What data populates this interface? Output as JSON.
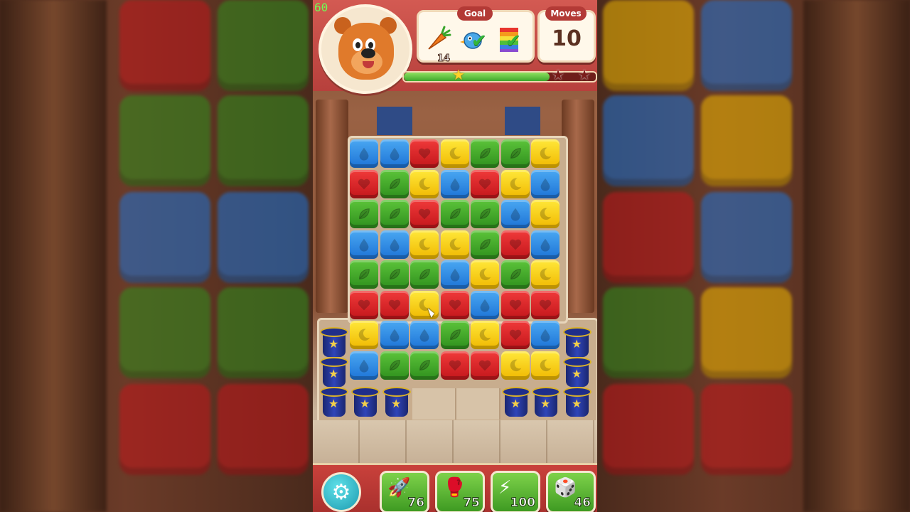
{
  "hud": {
    "fps": "60",
    "goal_label": "Goal",
    "moves_label": "Moves",
    "moves_value": "10",
    "goals": [
      {
        "icon": "carrot-icon",
        "count": "14",
        "done": false
      },
      {
        "icon": "bird-icon",
        "count": "",
        "done": true
      },
      {
        "icon": "rainbow-block-icon",
        "count": "",
        "done": true
      }
    ],
    "progress": 0.76,
    "stars": [
      "star-icon",
      "star-icon",
      "star-icon"
    ]
  },
  "colors": {
    "blue": "#1d73d6",
    "red": "#c3161b",
    "green": "#2f8f1d",
    "yellow": "#f0b800",
    "header": "#b7403c",
    "progress": "#3da72c"
  },
  "board": {
    "columns": 7,
    "rows": [
      [
        "blue",
        "blue",
        "red",
        "yellow",
        "green",
        "green",
        "yellow"
      ],
      [
        "red",
        "green",
        "yellow",
        "blue",
        "red",
        "yellow",
        "blue"
      ],
      [
        "green",
        "green",
        "red",
        "green",
        "green",
        "blue",
        "yellow"
      ],
      [
        "blue",
        "blue",
        "yellow",
        "yellow",
        "green",
        "red",
        "blue"
      ],
      [
        "green",
        "green",
        "green",
        "blue",
        "yellow",
        "green",
        "yellow"
      ],
      [
        "red",
        "red",
        "yellow",
        "red",
        "blue",
        "red",
        "red"
      ],
      [
        "yellow",
        "blue",
        "blue",
        "green",
        "yellow",
        "red",
        "blue"
      ],
      [
        "blue",
        "green",
        "green",
        "red",
        "red",
        "yellow",
        "yellow"
      ]
    ],
    "symbols": {
      "blue": "drop",
      "red": "heart",
      "green": "leaf",
      "yellow": "moon"
    }
  },
  "boosters": [
    {
      "name": "rocket-booster",
      "icon": "rocket-icon",
      "count": "76"
    },
    {
      "name": "boxing-glove-booster",
      "icon": "boxing-glove-icon",
      "count": "75"
    },
    {
      "name": "drill-booster",
      "icon": "drill-icon",
      "count": "100"
    },
    {
      "name": "dice-booster",
      "icon": "dice-icon",
      "count": "46"
    }
  ]
}
